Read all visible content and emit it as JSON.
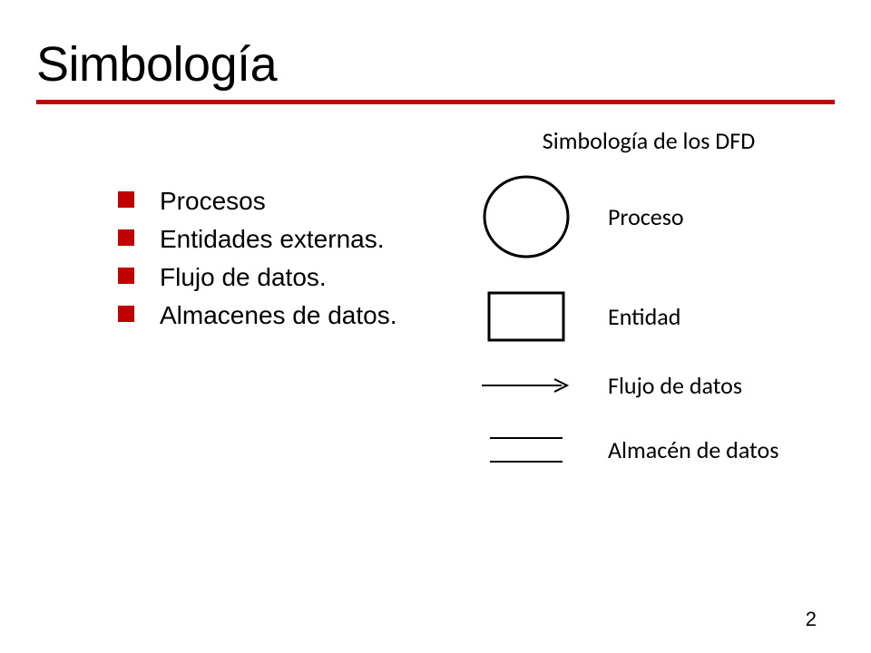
{
  "title": "Simbología",
  "bullets": [
    "Procesos",
    "Entidades externas.",
    "Flujo de datos.",
    "Almacenes de datos."
  ],
  "dfd": {
    "heading": "Simbología de los DFD",
    "rows": [
      {
        "name": "process",
        "label": "Proceso"
      },
      {
        "name": "entity",
        "label": "Entidad"
      },
      {
        "name": "flow",
        "label": "Flujo de datos"
      },
      {
        "name": "datastore",
        "label": "Almacén de datos"
      }
    ]
  },
  "pageNumber": "2"
}
